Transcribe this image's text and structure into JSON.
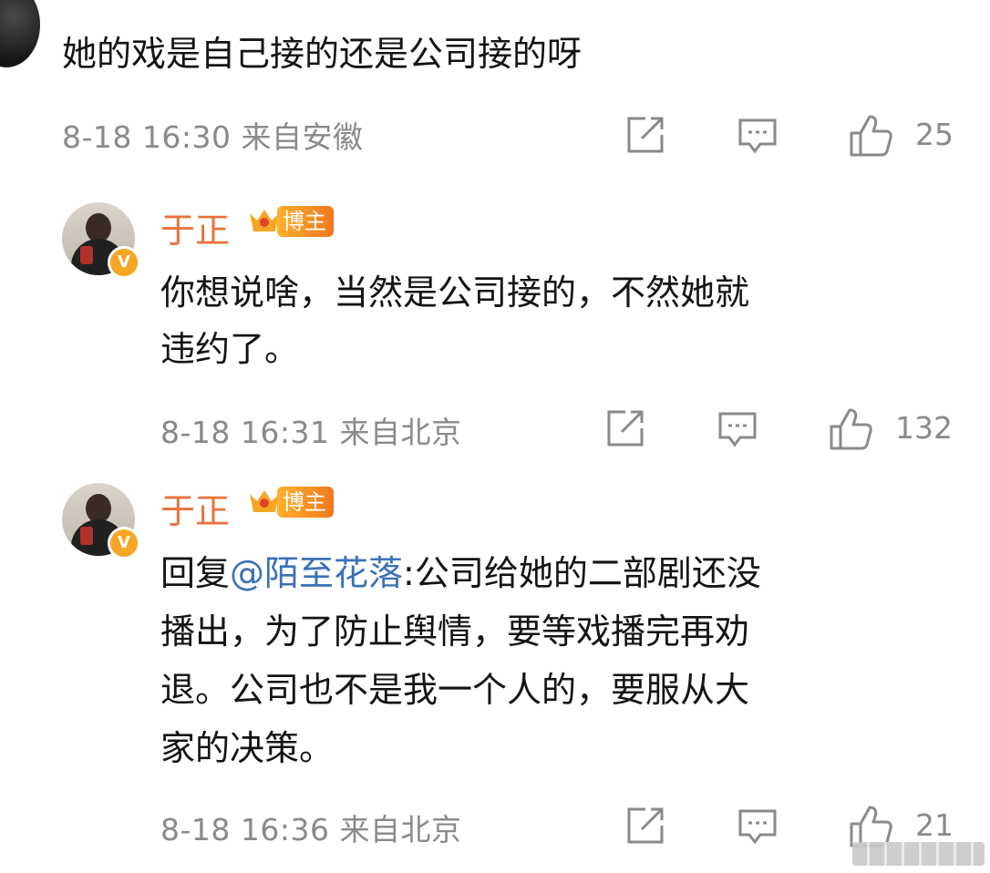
{
  "top_comment": {
    "username": "",
    "text": "她的戏是自己接的还是公司接的呀",
    "time": "8-18 16:30",
    "location": "来自安徽",
    "likes": "25"
  },
  "replies": [
    {
      "username": "于正",
      "badge": "博主",
      "lines": [
        "你想说啥，当然是公司接的，不然她就",
        "违约了。"
      ],
      "time": "8-18 16:31",
      "location": "来自北京",
      "likes": "132"
    },
    {
      "username": "于正",
      "badge": "博主",
      "reply_prefix": "回复",
      "mention": "@陌至花落",
      "first_line_rest": ":公司给她的二部剧还没",
      "lines": [
        "播出，为了防止舆情，要等戏播完再劝",
        "退。公司也不是我一个人的，要服从大",
        "家的决策。"
      ],
      "time": "8-18 16:36",
      "location": "来自北京",
      "likes": "21"
    }
  ],
  "icons": {
    "share": "share-icon",
    "comment": "comment-icon",
    "like": "thumbs-up-icon",
    "verified": "verified-v-icon",
    "crown": "crown-icon"
  },
  "colors": {
    "username": "#e8733a",
    "mention": "#3a71b8",
    "meta": "#8a8a8a",
    "badge": "#f5a623"
  }
}
